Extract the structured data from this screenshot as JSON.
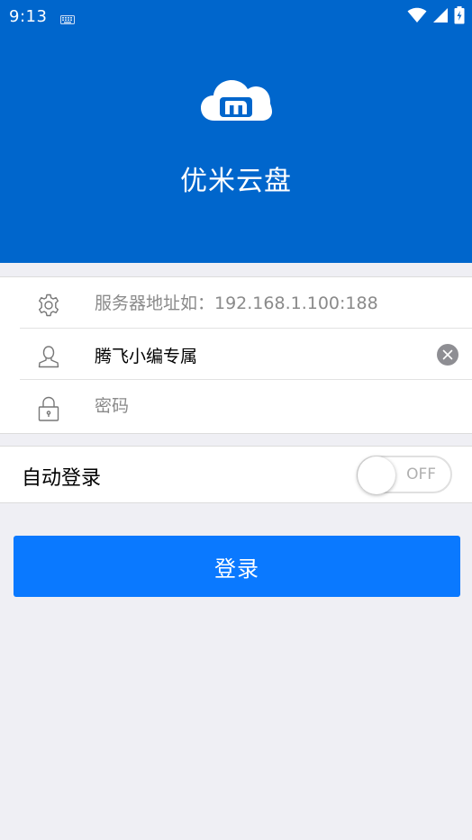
{
  "status_bar": {
    "time": "9:13"
  },
  "header": {
    "app_name": "优米云盘",
    "logo_icon": "cloud-m-logo"
  },
  "form": {
    "server": {
      "icon": "gear-icon",
      "value": "",
      "placeholder": "服务器地址如：192.168.1.100:188"
    },
    "username": {
      "icon": "user-icon",
      "value": "腾飞小编专属",
      "placeholder": ""
    },
    "password": {
      "icon": "lock-icon",
      "value": "",
      "placeholder": "密码"
    }
  },
  "auto_login": {
    "label": "自动登录",
    "toggle_state": "OFF"
  },
  "login_button": {
    "label": "登录"
  },
  "colors": {
    "header_blue": "#0066cc",
    "button_blue": "#0a79ff",
    "background": "#efeff4"
  }
}
